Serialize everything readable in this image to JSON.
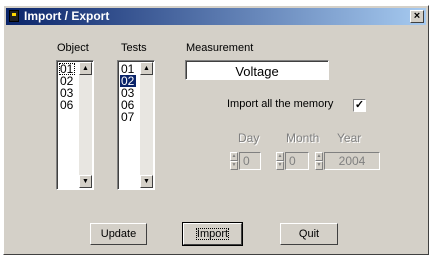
{
  "window": {
    "title": "Import / Export",
    "close_glyph": "×"
  },
  "object_list": {
    "label": "Object",
    "items": [
      "01",
      "02",
      "03",
      "06"
    ],
    "focused_index": 0
  },
  "tests_list": {
    "label": "Tests",
    "items": [
      "01",
      "02",
      "03",
      "06",
      "07"
    ],
    "selected_index": 1
  },
  "measurement": {
    "label": "Measurement",
    "value": "Voltage"
  },
  "import_all": {
    "label": "Import all the memory",
    "checked": true,
    "check_glyph": "✓"
  },
  "date": {
    "day": {
      "label": "Day",
      "value": "0"
    },
    "month": {
      "label": "Month",
      "value": "0"
    },
    "year": {
      "label": "Year",
      "value": "2004"
    }
  },
  "buttons": {
    "update": "Update",
    "import": "Import",
    "quit": "Quit"
  },
  "icons": {
    "app": "app-icon",
    "close": "close-icon",
    "scroll_up": "arrow-up-icon",
    "scroll_down": "arrow-down-icon"
  },
  "colors": {
    "titlebar_start": "#0a246a",
    "titlebar_end": "#a6caf0",
    "face": "#d4d0c8",
    "selection": "#0a246a"
  }
}
